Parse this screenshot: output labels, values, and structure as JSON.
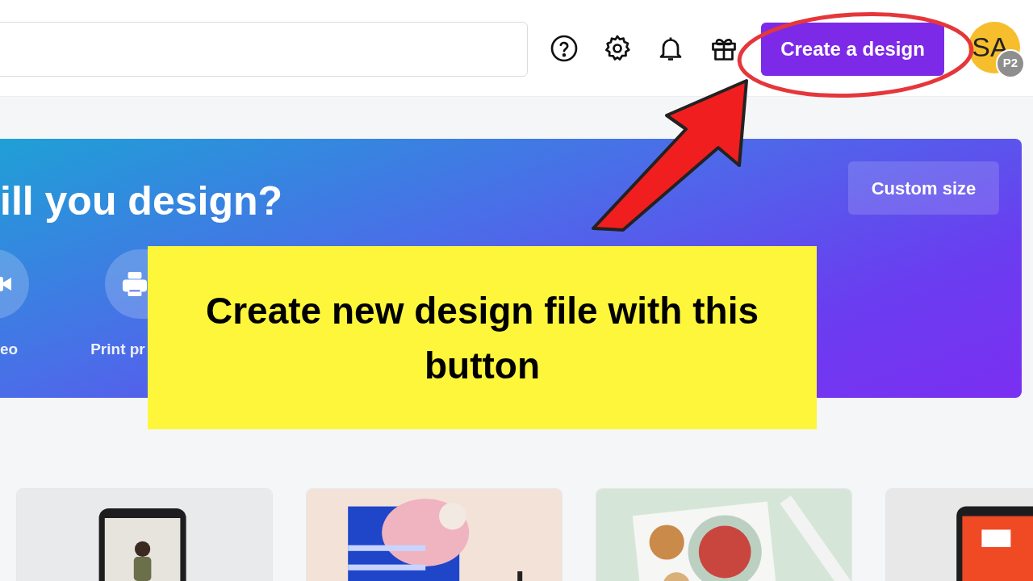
{
  "top_bar": {
    "create_button": "Create a design",
    "avatar": {
      "initials": "SA",
      "badge": "P2"
    }
  },
  "banner": {
    "title": "ill you design?",
    "custom_size_button": "Custom size",
    "shortcuts": [
      {
        "kind": "video",
        "label": "eo"
      },
      {
        "kind": "print",
        "label": "Print pr"
      }
    ]
  },
  "annotation": {
    "callout": "Create new design file with this button"
  }
}
